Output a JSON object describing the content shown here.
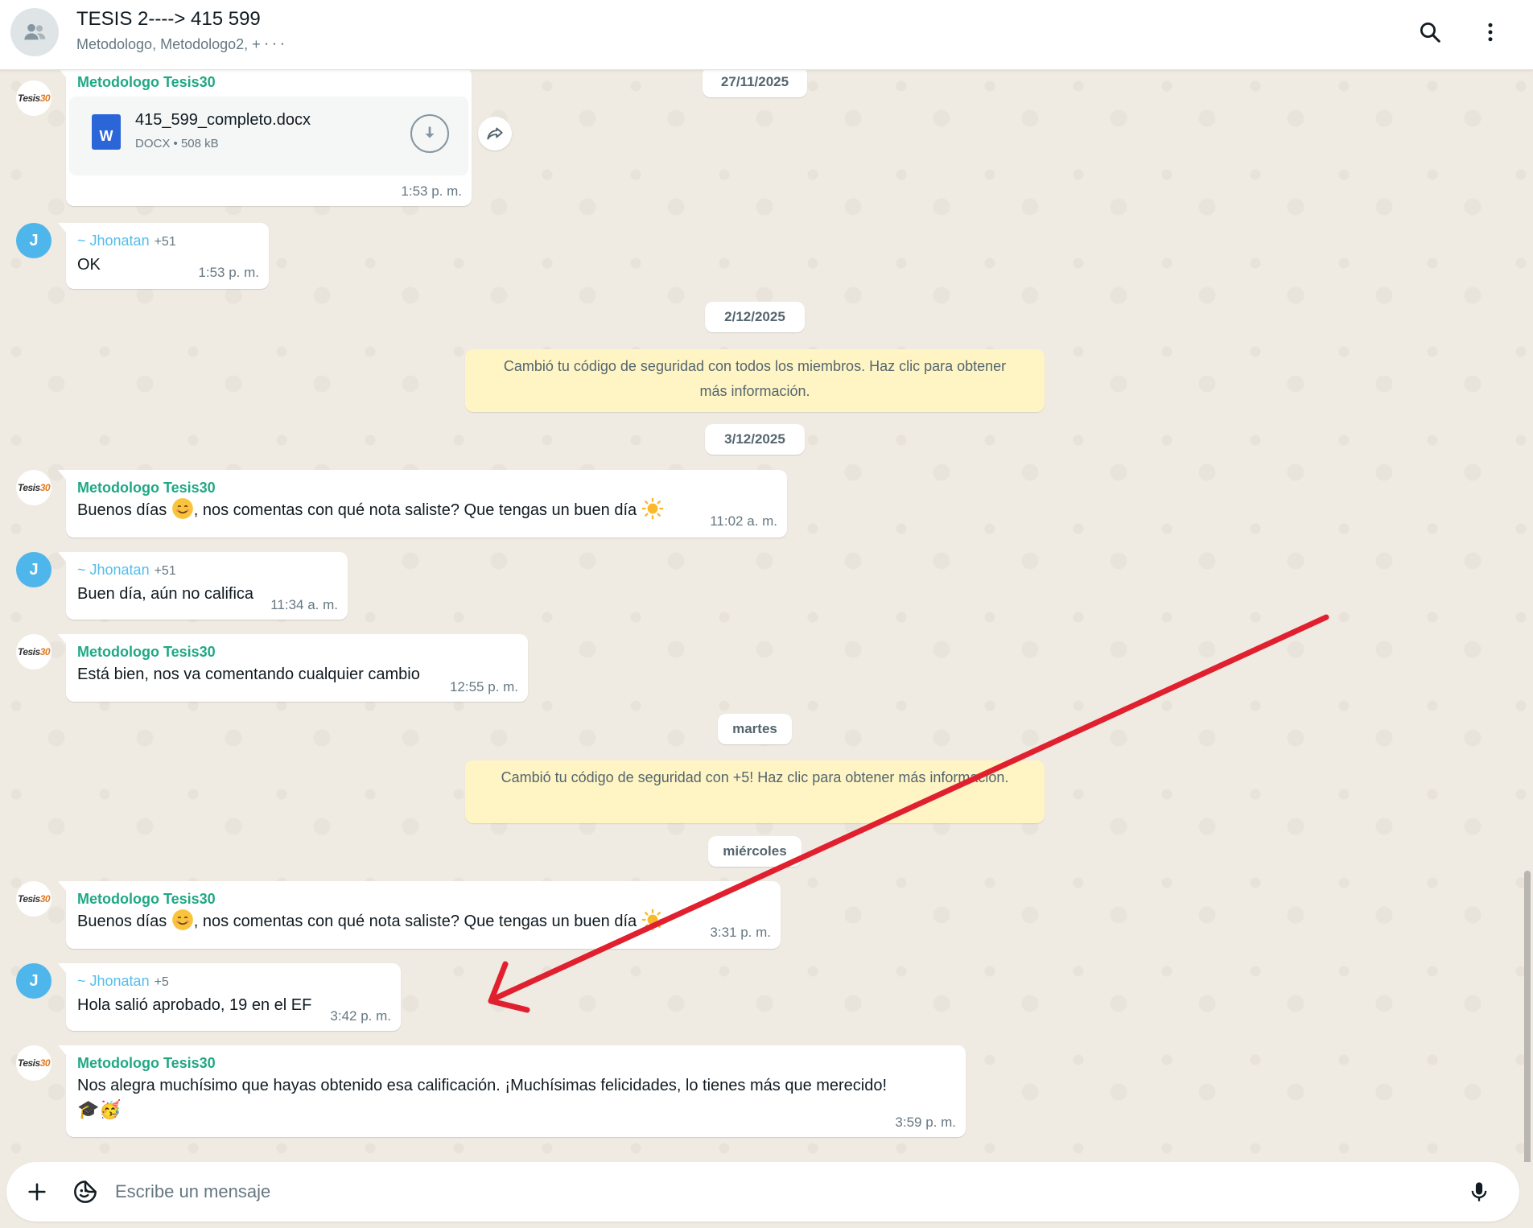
{
  "header": {
    "title": "TESIS 2----> 415 599",
    "subtitle": "Metodologo, Metodologo2, + ⸱ ⸱ ⸱",
    "icons": {
      "avatar": "group-icon",
      "search": "search-icon",
      "menu": "more-vert-icon"
    }
  },
  "dates": {
    "d1": "27/11/2025",
    "d2": "2/12/2025",
    "d3": "3/12/2025",
    "d4": "martes",
    "d5": "miércoles"
  },
  "system": {
    "s1": "Cambió tu código de seguridad con todos los miembros. Haz clic para obtener más información.",
    "s2": "Cambió tu código de seguridad con +5!                   Haz clic para obtener más información."
  },
  "messages": {
    "m1": {
      "sender": "Metodologo Tesis30",
      "doc_name": "415_599_completo.docx",
      "doc_type": "DOCX",
      "doc_size": "508 kB",
      "time": "1:53 p. m."
    },
    "m2": {
      "sender": "~ Jhonatan",
      "phone": "+51",
      "text": "OK",
      "time": "1:53 p. m."
    },
    "m3": {
      "sender": "Metodologo Tesis30",
      "text_a": "Buenos días",
      "text_b": ", nos comentas con qué nota saliste? Que tengas un buen día",
      "time": "11:02 a. m."
    },
    "m4": {
      "sender": "~ Jhonatan",
      "phone": "+51",
      "text": "Buen día, aún no califica",
      "time": "11:34 a. m."
    },
    "m5": {
      "sender": "Metodologo Tesis30",
      "text": "Está bien, nos va comentando cualquier cambio",
      "time": "12:55 p. m."
    },
    "m6": {
      "sender": "Metodologo Tesis30",
      "text_a": "Buenos días",
      "text_b": ", nos comentas con qué nota saliste? Que tengas un buen día",
      "time": "3:31 p. m."
    },
    "m7": {
      "sender": "~ Jhonatan",
      "phone": "+5",
      "text": "Hola salió aprobado, 19 en el EF",
      "time": "3:42 p. m."
    },
    "m8": {
      "sender": "Metodologo Tesis30",
      "text": "Nos alegra muchísimo que hayas obtenido esa calificación. ¡Muchísimas felicidades, lo tienes más que merecido!",
      "text2": "🎓🥳",
      "time": "3:59 p. m."
    }
  },
  "avatars": {
    "jhonatan_initial": "J",
    "logo_text": "Tesis30"
  },
  "compose": {
    "placeholder": "Escribe un mensaje"
  },
  "colors": {
    "accent_green": "#1fa884",
    "sender_blue": "#53bdeb",
    "system_bg": "#fff5c4",
    "chat_bg": "#efeae2",
    "annotation_arrow": "#e0202e"
  }
}
